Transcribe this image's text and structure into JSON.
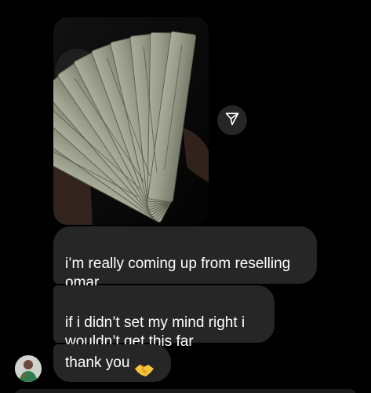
{
  "conversation": {
    "shared_photo": {
      "description_icon": "cash-fan-photo",
      "share_icon": "send-icon"
    },
    "messages": [
      {
        "text": "i’m really coming up from reselling\nomar"
      },
      {
        "text": "if i didn’t set my mind right i\nwouldn’t get this far"
      },
      {
        "text": "thank you",
        "emoji_icon": "handshake-icon"
      }
    ],
    "sender_avatar_icon": "avatar"
  },
  "colors": {
    "background": "#000000",
    "bubble": "#262626",
    "text": "#ffffff"
  }
}
